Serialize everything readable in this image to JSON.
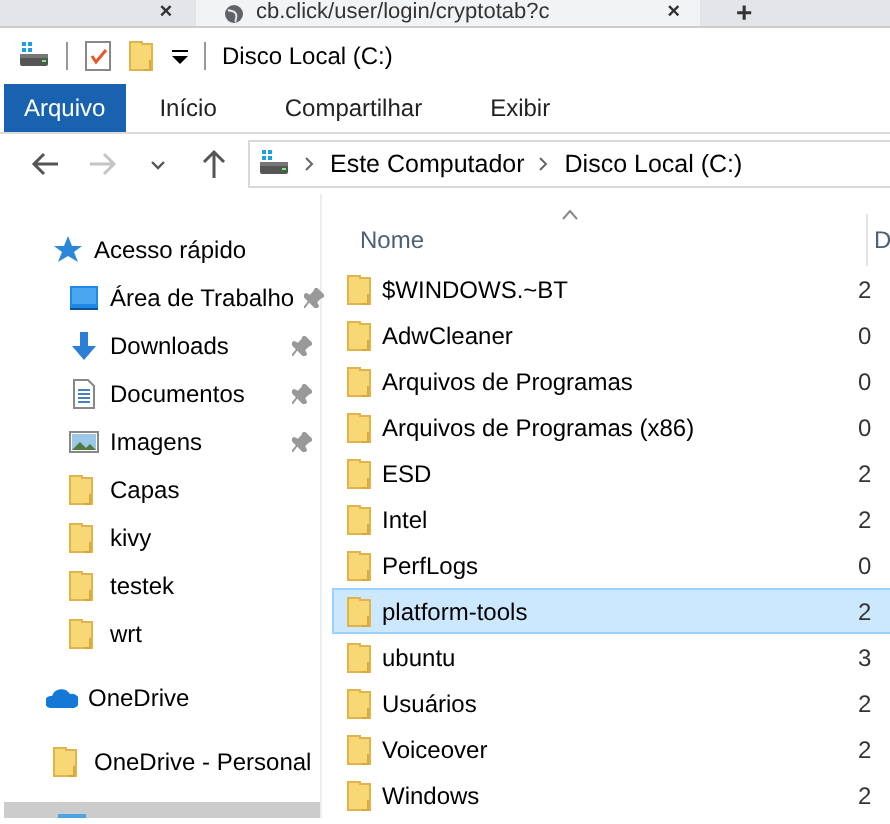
{
  "browser_tabs": {
    "previous_close": "×",
    "title": "cb.click/user/login/cryptotab?c",
    "close": "×",
    "new_tab": "+"
  },
  "window": {
    "title": "Disco Local (C:)"
  },
  "ribbon_tabs": [
    {
      "label": "Arquivo",
      "selected": true
    },
    {
      "label": "Início",
      "selected": false
    },
    {
      "label": "Compartilhar",
      "selected": false
    },
    {
      "label": "Exibir",
      "selected": false
    }
  ],
  "navigation": [
    {
      "kind": "back",
      "disabled": false
    },
    {
      "kind": "forward",
      "disabled": true
    },
    {
      "kind": "recent",
      "disabled": false
    },
    {
      "kind": "up",
      "disabled": false
    }
  ],
  "breadcrumb": [
    "Este Computador",
    "Disco Local (C:)"
  ],
  "sidebar": {
    "items": [
      {
        "label": "Acesso rápido",
        "kind": "quick-access",
        "selected": false,
        "children": [
          {
            "label": "Área de Trabalho",
            "kind": "desktop",
            "pinned": true,
            "selected": false
          },
          {
            "label": "Downloads",
            "kind": "downloads",
            "pinned": true,
            "selected": false
          },
          {
            "label": "Documentos",
            "kind": "documents",
            "pinned": true,
            "selected": false
          },
          {
            "label": "Imagens",
            "kind": "pictures",
            "pinned": true,
            "selected": false
          },
          {
            "label": "Capas",
            "kind": "folder",
            "pinned": false,
            "selected": false
          },
          {
            "label": "kivy",
            "kind": "folder",
            "pinned": false,
            "selected": false
          },
          {
            "label": "testek",
            "kind": "folder",
            "pinned": false,
            "selected": false
          },
          {
            "label": "wrt",
            "kind": "folder",
            "pinned": false,
            "selected": false
          }
        ]
      },
      {
        "label": "OneDrive",
        "kind": "onedrive",
        "selected": false
      },
      {
        "label": "OneDrive - Personal",
        "kind": "folder",
        "selected": false
      },
      {
        "kind": "computer",
        "selected": true
      }
    ]
  },
  "files": {
    "columns": [
      {
        "label": "Nome",
        "sorted_ascending": true
      },
      {
        "label": "D"
      }
    ],
    "rows": [
      {
        "name": "$WINDOWS.~BT",
        "column_2": "2",
        "selected": false
      },
      {
        "name": "AdwCleaner",
        "column_2": "0",
        "selected": false
      },
      {
        "name": "Arquivos de Programas",
        "column_2": "0",
        "selected": false
      },
      {
        "name": "Arquivos de Programas (x86)",
        "column_2": "0",
        "selected": false
      },
      {
        "name": "ESD",
        "column_2": "2",
        "selected": false
      },
      {
        "name": "Intel",
        "column_2": "2",
        "selected": false
      },
      {
        "name": "PerfLogs",
        "column_2": "0",
        "selected": false
      },
      {
        "name": "platform-tools",
        "column_2": "2",
        "selected": true
      },
      {
        "name": "ubuntu",
        "column_2": "3",
        "selected": false
      },
      {
        "name": "Usuários",
        "column_2": "2",
        "selected": false
      },
      {
        "name": "Voiceover",
        "column_2": "2",
        "selected": false
      },
      {
        "name": "Windows",
        "column_2": "2",
        "selected": false
      }
    ]
  }
}
